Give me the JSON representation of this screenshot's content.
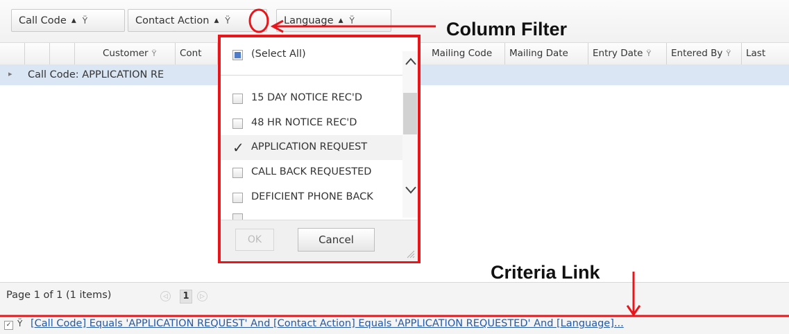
{
  "group_panel": {
    "chips": [
      {
        "label": "Call Code",
        "sort": "▲",
        "filter": "Ÿ"
      },
      {
        "label": "Contact Action",
        "sort": "▲",
        "filter": "Ÿ"
      },
      {
        "label": "Language",
        "sort": "▲",
        "filter": "Ÿ"
      }
    ]
  },
  "columns": [
    "Customer",
    "Cont",
    "Mailing Code",
    "Mailing Date",
    "Entry Date",
    "Entered By",
    "Last"
  ],
  "group_row": {
    "text": "Call Code: APPLICATION RE",
    "expander": "▸"
  },
  "filter_popup": {
    "select_all": "(Select All)",
    "items": [
      {
        "label": "15 DAY NOTICE REC'D",
        "checked": false
      },
      {
        "label": "48 HR NOTICE REC'D",
        "checked": false
      },
      {
        "label": "APPLICATION REQUEST",
        "checked": true
      },
      {
        "label": "CALL BACK REQUESTED",
        "checked": false
      },
      {
        "label": "DEFICIENT PHONE BACK",
        "checked": false
      }
    ],
    "ok": "OK",
    "cancel": "Cancel"
  },
  "pager": {
    "info": "Page 1 of 1 (1 items)",
    "page": "1",
    "prev": "◁",
    "next": "▷"
  },
  "filter_bar": {
    "criteria": "[Call Code] Equals 'APPLICATION REQUEST' And [Contact Action] Equals 'APPLICATION REQUESTED' And [Language]..."
  },
  "annotations": {
    "column_filter": "Column Filter",
    "criteria_link": "Criteria Link"
  },
  "colors": {
    "annotation_red": "#e8151b",
    "link_blue": "#2559a7",
    "group_row_bg": "#dbe6f5"
  }
}
